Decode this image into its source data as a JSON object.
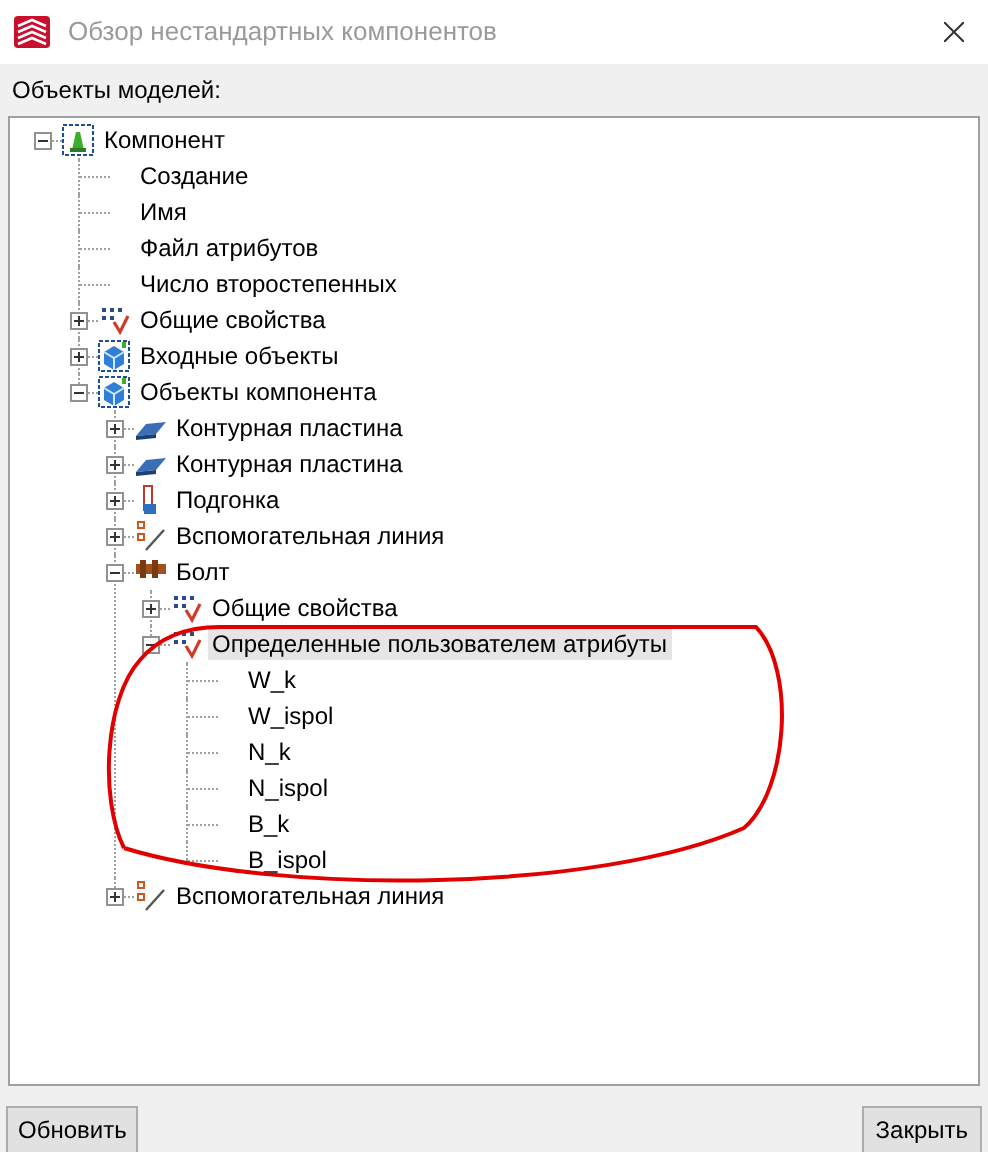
{
  "window": {
    "title": "Обзор нестандартных компонентов"
  },
  "tree_label": "Объекты моделей:",
  "tree": [
    {
      "label": "Компонент",
      "kind": "component",
      "expanded": true,
      "selected": false,
      "children": [
        {
          "label": "Создание",
          "kind": "leaf",
          "selected": false
        },
        {
          "label": "Имя",
          "kind": "leaf",
          "selected": false
        },
        {
          "label": "Файл атрибутов",
          "kind": "leaf",
          "selected": false
        },
        {
          "label": "Число второстепенных",
          "kind": "leaf",
          "selected": false
        },
        {
          "label": "Общие свойства",
          "kind": "properties",
          "expanded": false,
          "selected": false
        },
        {
          "label": "Входные объекты",
          "kind": "objects",
          "expanded": false,
          "selected": false
        },
        {
          "label": "Объекты компонента",
          "kind": "objects",
          "expanded": true,
          "selected": false,
          "children": [
            {
              "label": "Контурная пластина",
              "kind": "plate",
              "expanded": false,
              "selected": false
            },
            {
              "label": "Контурная пластина",
              "kind": "plate",
              "expanded": false,
              "selected": false
            },
            {
              "label": "Подгонка",
              "kind": "fitting",
              "expanded": false,
              "selected": false
            },
            {
              "label": "Вспомогательная линия",
              "kind": "line",
              "expanded": false,
              "selected": false
            },
            {
              "label": "Болт",
              "kind": "bolt",
              "expanded": true,
              "selected": false,
              "children": [
                {
                  "label": "Общие свойства",
                  "kind": "properties",
                  "expanded": false,
                  "selected": false
                },
                {
                  "label": "Определенные пользователем атрибуты",
                  "kind": "properties",
                  "expanded": true,
                  "selected": true,
                  "children": [
                    {
                      "label": "W_k",
                      "kind": "leaf",
                      "selected": false
                    },
                    {
                      "label": "W_ispol",
                      "kind": "leaf",
                      "selected": false
                    },
                    {
                      "label": "N_k",
                      "kind": "leaf",
                      "selected": false
                    },
                    {
                      "label": "N_ispol",
                      "kind": "leaf",
                      "selected": false
                    },
                    {
                      "label": "B_k",
                      "kind": "leaf",
                      "selected": false
                    },
                    {
                      "label": "B_ispol",
                      "kind": "leaf",
                      "selected": false
                    }
                  ]
                }
              ]
            },
            {
              "label": "Вспомогательная линия",
              "kind": "line",
              "expanded": false,
              "selected": false
            }
          ]
        }
      ]
    }
  ],
  "buttons": [
    {
      "label": "Обновить"
    },
    {
      "label": "Закрыть"
    }
  ]
}
